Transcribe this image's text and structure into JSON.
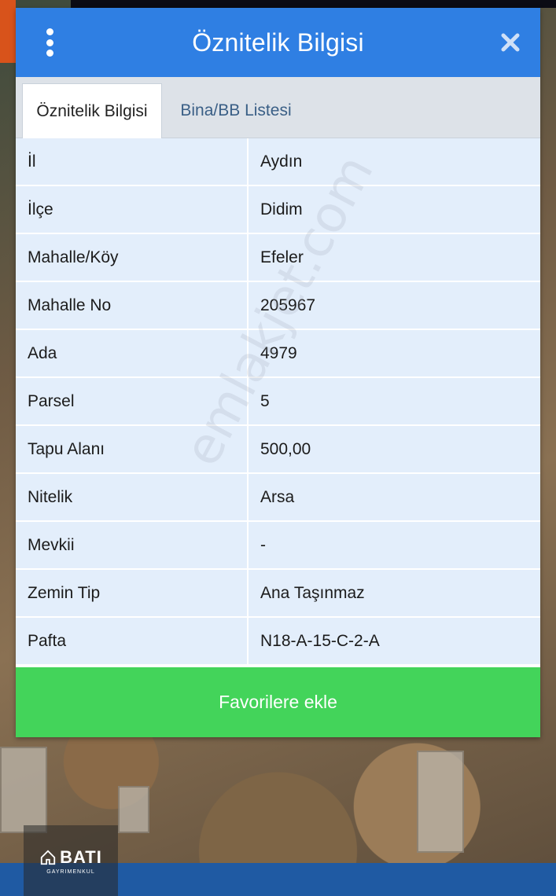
{
  "dialog": {
    "title": "Öznitelik Bilgisi",
    "accent_color": "#2f7fe3",
    "menu_icon": "more-vertical-icon",
    "close_icon": "close-icon"
  },
  "tabs": [
    {
      "label": "Öznitelik Bilgisi",
      "active": true
    },
    {
      "label": "Bina/BB Listesi",
      "active": false
    }
  ],
  "attributes": [
    {
      "key": "İl",
      "value": "Aydın"
    },
    {
      "key": "İlçe",
      "value": "Didim"
    },
    {
      "key": "Mahalle/Köy",
      "value": "Efeler"
    },
    {
      "key": "Mahalle No",
      "value": "205967"
    },
    {
      "key": "Ada",
      "value": "4979"
    },
    {
      "key": "Parsel",
      "value": "5"
    },
    {
      "key": "Tapu Alanı",
      "value": "500,00"
    },
    {
      "key": "Nitelik",
      "value": "Arsa"
    },
    {
      "key": "Mevkii",
      "value": "-"
    },
    {
      "key": "Zemin Tip",
      "value": "Ana Taşınmaz"
    },
    {
      "key": "Pafta",
      "value": "N18-A-15-C-2-A"
    }
  ],
  "favorite_button": {
    "label": "Favorilere ekle",
    "color": "#43d45a"
  },
  "watermark": "emlakjet.com",
  "logo": {
    "name": "BATI",
    "subtitle": "GAYRIMENKUL"
  }
}
